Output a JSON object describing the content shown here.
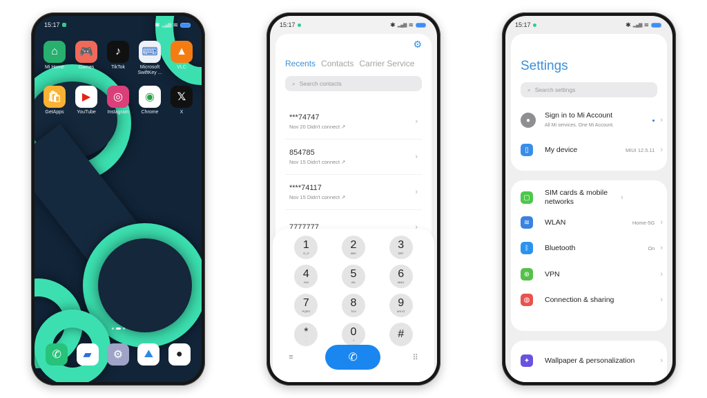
{
  "status_bar": {
    "time": "15:17"
  },
  "home": {
    "apps": [
      {
        "label": "Mi Home",
        "icon": "mi-home-icon",
        "glyph": "⌂",
        "color": "#27b06e"
      },
      {
        "label": "Games",
        "icon": "games-icon",
        "glyph": "🎮",
        "color": "#f06a5a"
      },
      {
        "label": "TikTok",
        "icon": "tiktok-icon",
        "glyph": "♪",
        "color": "#111111"
      },
      {
        "label": "Microsoft SwiftKey ...",
        "icon": "swiftkey-icon",
        "glyph": "⌨",
        "color": "#eef1f6"
      },
      {
        "label": "VLC",
        "icon": "vlc-icon",
        "glyph": "▲",
        "color": "#f57c12"
      },
      {
        "label": "GetApps",
        "icon": "getapps-icon",
        "glyph": "🛍",
        "color": "#f9b233"
      },
      {
        "label": "YouTube",
        "icon": "youtube-icon",
        "glyph": "▶",
        "color": "#ffffff"
      },
      {
        "label": "Instagram",
        "icon": "instagram-icon",
        "glyph": "◎",
        "color": "#d9407a"
      },
      {
        "label": "Chrome",
        "icon": "chrome-icon",
        "glyph": "◉",
        "color": "#ffffff"
      },
      {
        "label": "X",
        "icon": "x-icon",
        "glyph": "𝕏",
        "color": "#111111"
      }
    ],
    "dock": [
      {
        "name": "phone",
        "icon": "phone-icon",
        "glyph": "✆",
        "color": "#27c37a"
      },
      {
        "name": "messages",
        "icon": "messages-icon",
        "glyph": "▰",
        "color": "#ffffff"
      },
      {
        "name": "settings",
        "icon": "settings-gear-icon",
        "glyph": "⚙",
        "color": "#9ea3c7"
      },
      {
        "name": "gallery",
        "icon": "gallery-icon",
        "glyph": "⛰",
        "color": "#ffffff"
      },
      {
        "name": "camera",
        "icon": "camera-icon",
        "glyph": "●",
        "color": "#ffffff"
      }
    ]
  },
  "dialer": {
    "tabs": [
      {
        "label": "Recents",
        "active": true
      },
      {
        "label": "Contacts",
        "active": false
      },
      {
        "label": "Carrier Service",
        "active": false
      }
    ],
    "search_placeholder": "Search contacts",
    "recents": [
      {
        "number": "***74747",
        "detail": "Nov 20 Didn't connect"
      },
      {
        "number": "854785",
        "detail": "Nov 15 Didn't connect"
      },
      {
        "number": "****74117",
        "detail": "Nov 15 Didn't connect"
      },
      {
        "number": "7777777",
        "detail": ""
      }
    ],
    "keys": [
      {
        "digit": "1",
        "letters": "O_O"
      },
      {
        "digit": "2",
        "letters": "ABC"
      },
      {
        "digit": "3",
        "letters": "DEF"
      },
      {
        "digit": "4",
        "letters": "GHI"
      },
      {
        "digit": "5",
        "letters": "JKL"
      },
      {
        "digit": "6",
        "letters": "MNO"
      },
      {
        "digit": "7",
        "letters": "PQRS"
      },
      {
        "digit": "8",
        "letters": "TUV"
      },
      {
        "digit": "9",
        "letters": "WXYZ"
      },
      {
        "digit": "*",
        "letters": ","
      },
      {
        "digit": "0",
        "letters": "+"
      },
      {
        "digit": "#",
        "letters": ""
      }
    ]
  },
  "settings": {
    "title": "Settings",
    "search_placeholder": "Search settings",
    "account": {
      "label": "Sign in to Mi Account",
      "sub": "All Mi services. One Mi Account."
    },
    "device": {
      "label": "My device",
      "value": "MIUI 12.5.11"
    },
    "items": [
      {
        "label": "SIM cards & mobile networks",
        "value": "",
        "icon": "sim-card-icon",
        "glyph": "▢",
        "color": "#4cc84a"
      },
      {
        "label": "WLAN",
        "value": "Home-5G",
        "icon": "wifi-icon",
        "glyph": "≋",
        "color": "#3a82e0"
      },
      {
        "label": "Bluetooth",
        "value": "On",
        "icon": "bluetooth-icon",
        "glyph": "ᛒ",
        "color": "#2d92ee"
      },
      {
        "label": "VPN",
        "value": "",
        "icon": "vpn-globe-icon",
        "glyph": "⊕",
        "color": "#55c04a"
      },
      {
        "label": "Connection & sharing",
        "value": "",
        "icon": "connection-sharing-icon",
        "glyph": "◍",
        "color": "#e8534f"
      }
    ],
    "personalization": {
      "label": "Wallpaper & personalization",
      "icon": "wallpaper-icon",
      "glyph": "✦",
      "color": "#6a52e0"
    }
  }
}
